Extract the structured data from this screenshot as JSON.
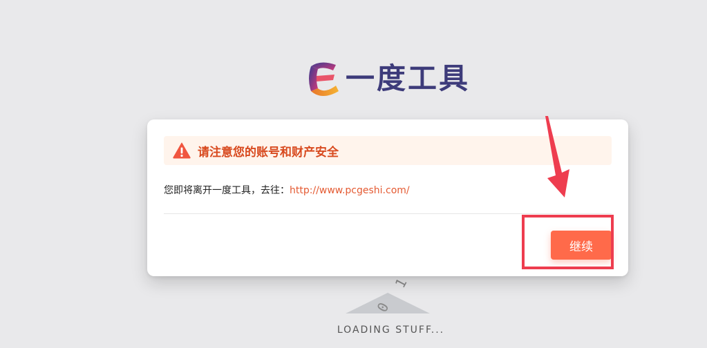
{
  "brand": {
    "title": "一度工具"
  },
  "dialog": {
    "warning_title": "请注意您的账号和财产安全",
    "message_prefix": "您即将离开一度工具，去往：",
    "target_url": "http://www.pcgeshi.com/",
    "continue_label": "继续"
  },
  "loader": {
    "digit_top": "1",
    "digit_bottom": "0",
    "text": "LOADING STUFF..."
  },
  "annotation": {
    "color": "#ee3d4f"
  },
  "colors": {
    "background": "#e9e9eb",
    "accent": "#ff6a4a",
    "warning_text": "#d84a1f",
    "link": "#e45a32",
    "brand_text": "#3d3b7a"
  }
}
